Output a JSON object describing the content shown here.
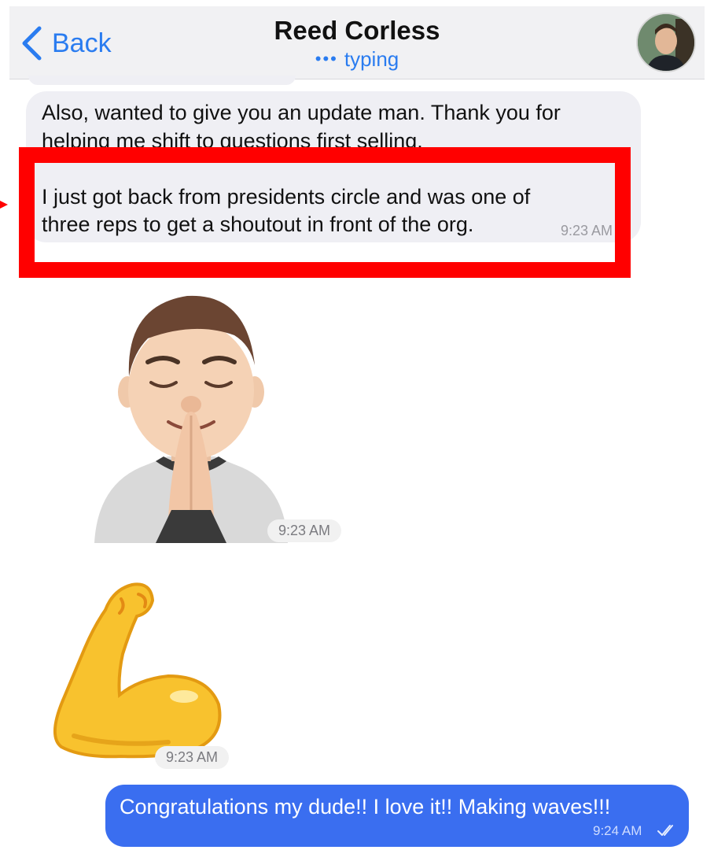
{
  "header": {
    "back_label": "Back",
    "contact_name": "Reed Corless",
    "status": "typing",
    "status_dots": "•••"
  },
  "messages": {
    "incoming": {
      "lines": [
        "Also, wanted to give you an update man. Thank you for",
        "helping me shift to questions first selling.",
        "I just got back from presidents circle and was one of",
        "three reps to get a shoutout in front of the org."
      ],
      "time": "9:23 AM"
    },
    "memoji_sticker": {
      "icon": "memoji-praying-hands-icon",
      "time": "9:23 AM"
    },
    "bicep_sticker": {
      "icon": "flexed-biceps-icon",
      "time": "9:23 AM"
    },
    "outgoing": {
      "text": "Congratulations my dude!! I love it!! Making waves!!!",
      "time": "9:24 AM",
      "status_icon": "double-check-icon"
    }
  },
  "colors": {
    "accent": "#2a7cf0",
    "outgoing_bubble": "#3a6ef0",
    "incoming_bubble": "#efeff4",
    "highlight": "#ff0000"
  }
}
